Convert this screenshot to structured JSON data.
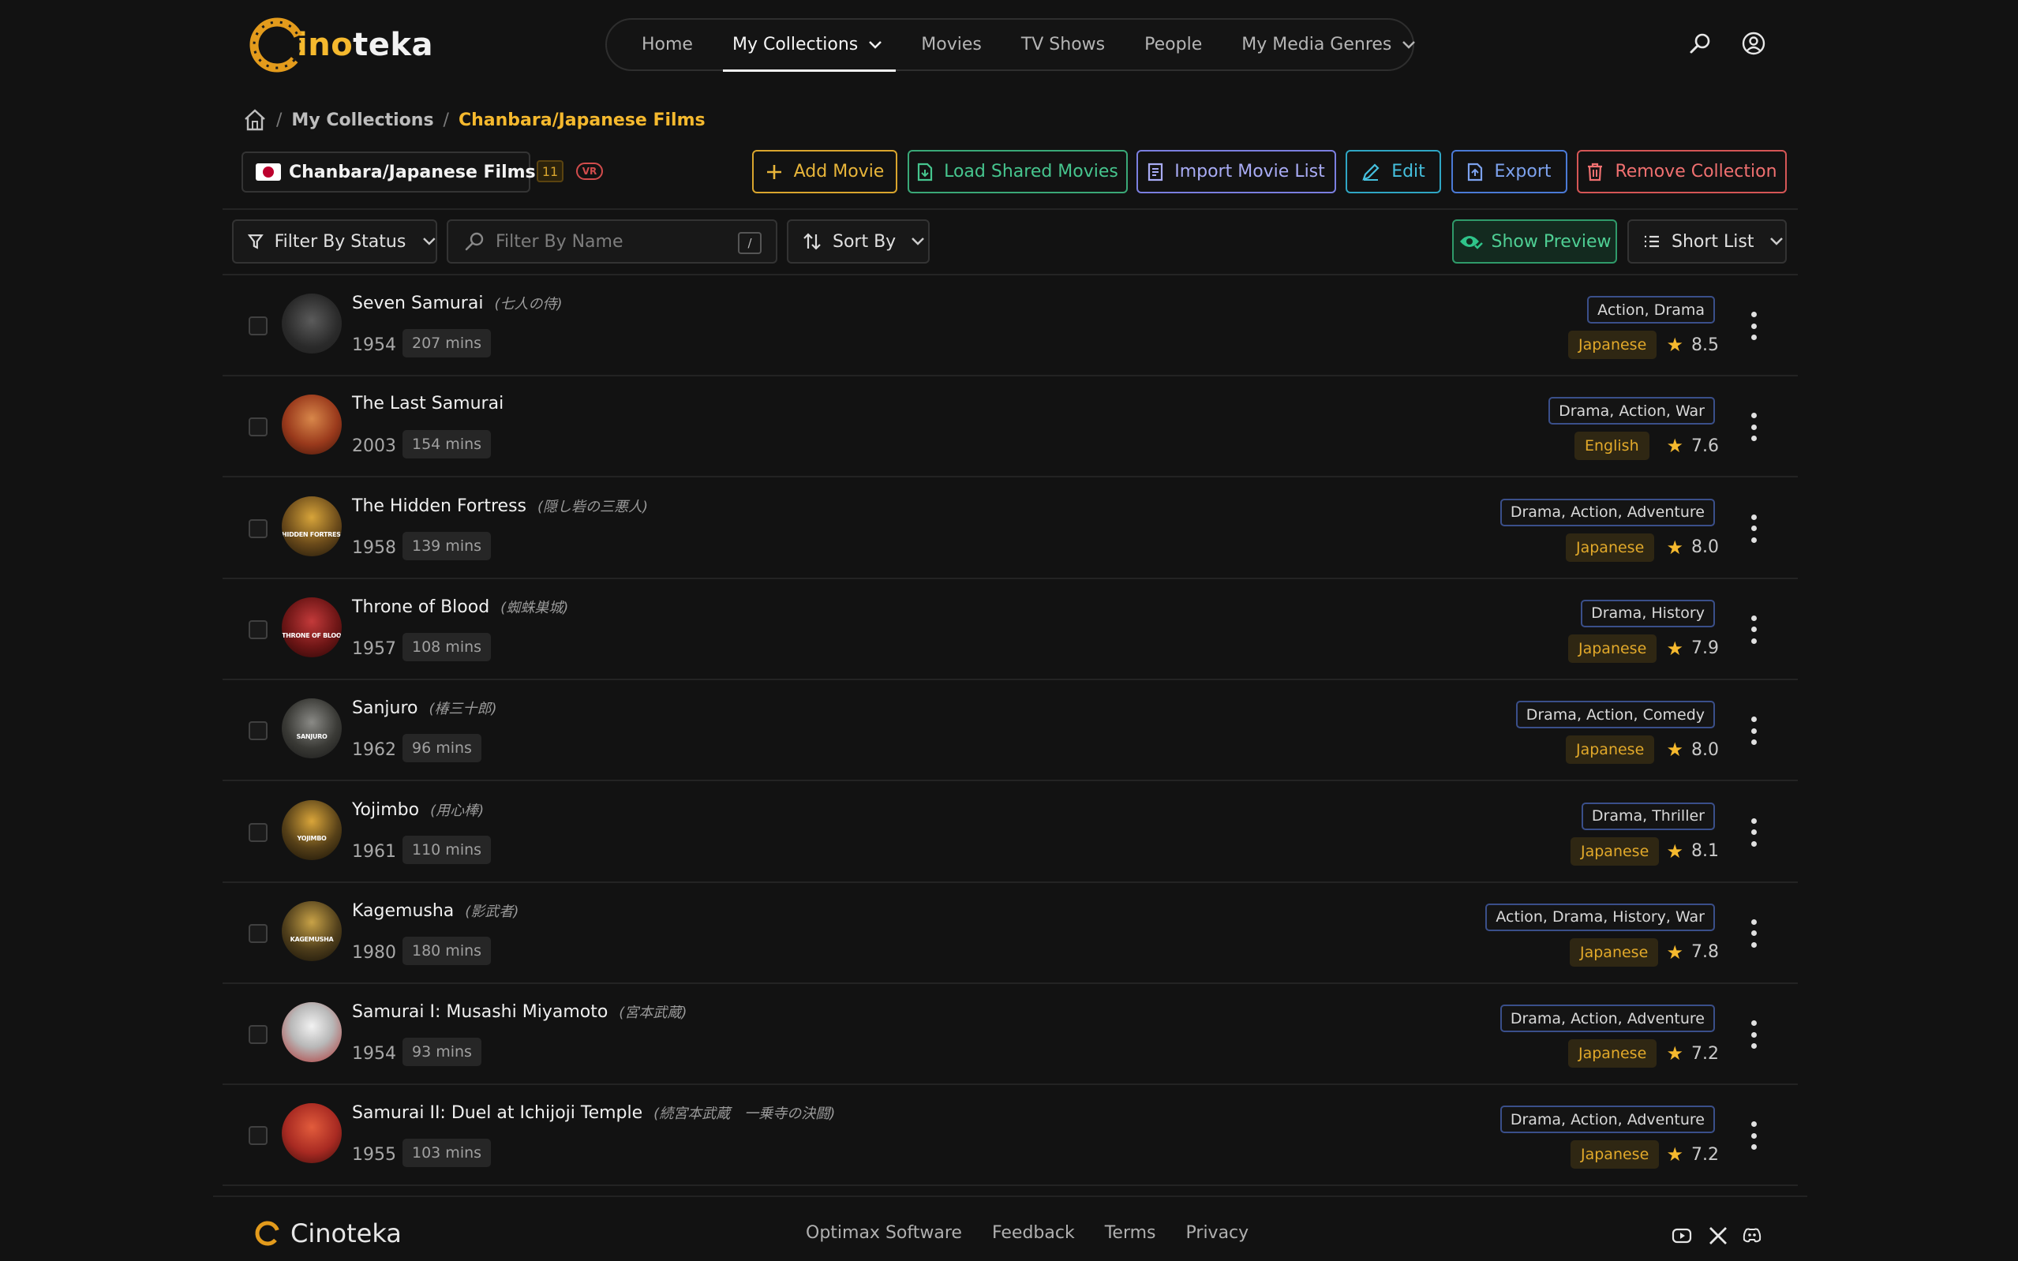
{
  "brand": {
    "logo_first": "C",
    "logo_highlight": "ino",
    "logo_rest": "teka",
    "footer_name": "Cinoteka"
  },
  "nav": {
    "items": [
      {
        "label": "Home"
      },
      {
        "label": "My Collections"
      },
      {
        "label": "Movies"
      },
      {
        "label": "TV Shows"
      },
      {
        "label": "People"
      },
      {
        "label": "My Media Genres"
      }
    ],
    "active": "My Collections"
  },
  "breadcrumb": {
    "home_icon": "home-icon",
    "parent": "My Collections",
    "current": "Chanbara/Japanese Films"
  },
  "collection": {
    "name": "Chanbara/Japanese Films",
    "count": "11",
    "vr_badge": "VR"
  },
  "actions": {
    "add_movie": "Add Movie",
    "load_shared": "Load Shared Movies",
    "import_list": "Import Movie List",
    "edit": "Edit",
    "export": "Export",
    "remove": "Remove Collection"
  },
  "filters": {
    "status": "Filter By Status",
    "name_placeholder": "Filter By Name",
    "shortcut": "/",
    "sort": "Sort By",
    "preview": "Show Preview",
    "view_mode": "Short List"
  },
  "colors": {
    "accent": "#f5b92e",
    "watched": "#2fc48a",
    "unwatched": "#d64545"
  },
  "movies": [
    {
      "title": "Seven Samurai",
      "original": "(七人の侍)",
      "year": "1954",
      "runtime": "207 mins",
      "genres": "Action, Drama",
      "language": "Japanese",
      "rating": "8.5",
      "watched": true,
      "poster_caption": ""
    },
    {
      "title": "The Last Samurai",
      "original": "",
      "year": "2003",
      "runtime": "154 mins",
      "genres": "Drama, Action, War",
      "language": "English",
      "rating": "7.6",
      "watched": true,
      "poster_caption": ""
    },
    {
      "title": "The Hidden Fortress",
      "original": "(隠し砦の三悪人)",
      "year": "1958",
      "runtime": "139 mins",
      "genres": "Drama, Action, Adventure",
      "language": "Japanese",
      "rating": "8.0",
      "watched": true,
      "poster_caption": "HIDDEN FORTRESS"
    },
    {
      "title": "Throne of Blood",
      "original": "(蜘蛛巣城)",
      "year": "1957",
      "runtime": "108 mins",
      "genres": "Drama, History",
      "language": "Japanese",
      "rating": "7.9",
      "watched": false,
      "poster_caption": "THRONE OF BLOOD"
    },
    {
      "title": "Sanjuro",
      "original": "(椿三十郎)",
      "year": "1962",
      "runtime": "96 mins",
      "genres": "Drama, Action, Comedy",
      "language": "Japanese",
      "rating": "8.0",
      "watched": false,
      "poster_caption": "SANJURO"
    },
    {
      "title": "Yojimbo",
      "original": "(用心棒)",
      "year": "1961",
      "runtime": "110 mins",
      "genres": "Drama, Thriller",
      "language": "Japanese",
      "rating": "8.1",
      "watched": false,
      "poster_caption": "YOJIMBO"
    },
    {
      "title": "Kagemusha",
      "original": "(影武者)",
      "year": "1980",
      "runtime": "180 mins",
      "genres": "Action, Drama, History, War",
      "language": "Japanese",
      "rating": "7.8",
      "watched": false,
      "poster_caption": "KAGEMUSHA"
    },
    {
      "title": "Samurai I: Musashi Miyamoto",
      "original": "(宮本武蔵)",
      "year": "1954",
      "runtime": "93 mins",
      "genres": "Drama, Action, Adventure",
      "language": "Japanese",
      "rating": "7.2",
      "watched": true,
      "poster_caption": ""
    },
    {
      "title": "Samurai II: Duel at Ichijoji Temple",
      "original": "(続宮本武蔵　一乗寺の決闘)",
      "year": "1955",
      "runtime": "103 mins",
      "genres": "Drama, Action, Adventure",
      "language": "Japanese",
      "rating": "7.2",
      "watched": true,
      "poster_caption": ""
    }
  ],
  "footer": {
    "links": [
      "Optimax Software",
      "Feedback",
      "Terms",
      "Privacy"
    ],
    "social": [
      "youtube-icon",
      "x-icon",
      "discord-icon"
    ]
  }
}
